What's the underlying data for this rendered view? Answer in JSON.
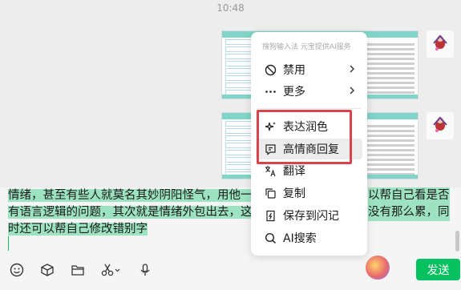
{
  "timestamp": "10:48",
  "input": {
    "lines": [
      "情绪，甚至有些人就莫名其妙阴阳怪气，用他一方",
      "有语言逻辑的问题，其次就是情绪外包出去，这样",
      "时还可以帮自己修改错别字"
    ],
    "right_frag": [
      "以帮自己看是否",
      "没有那么累，同"
    ]
  },
  "context_menu": {
    "header": "搜狗输入法  元宝提供AI服务",
    "items": [
      {
        "label": "禁用",
        "icon": "ban-icon",
        "has_submenu": true
      },
      {
        "label": "更多",
        "icon": "more-icon",
        "has_submenu": true
      },
      {
        "label": "表达润色",
        "icon": "sparkle-icon",
        "has_submenu": false
      },
      {
        "label": "高情商回复",
        "icon": "reply-icon",
        "has_submenu": false
      },
      {
        "label": "翻译",
        "icon": "translate-icon",
        "has_submenu": false
      },
      {
        "label": "复制",
        "icon": "copy-icon",
        "has_submenu": false
      },
      {
        "label": "保存到闪记",
        "icon": "save-note-icon",
        "has_submenu": false
      },
      {
        "label": "AI搜索",
        "icon": "search-icon",
        "has_submenu": false
      }
    ]
  },
  "send_label": "发送",
  "colors": {
    "accent": "#07c160",
    "highlight_border": "#d9434c",
    "text_selection": "#9de3c1"
  }
}
